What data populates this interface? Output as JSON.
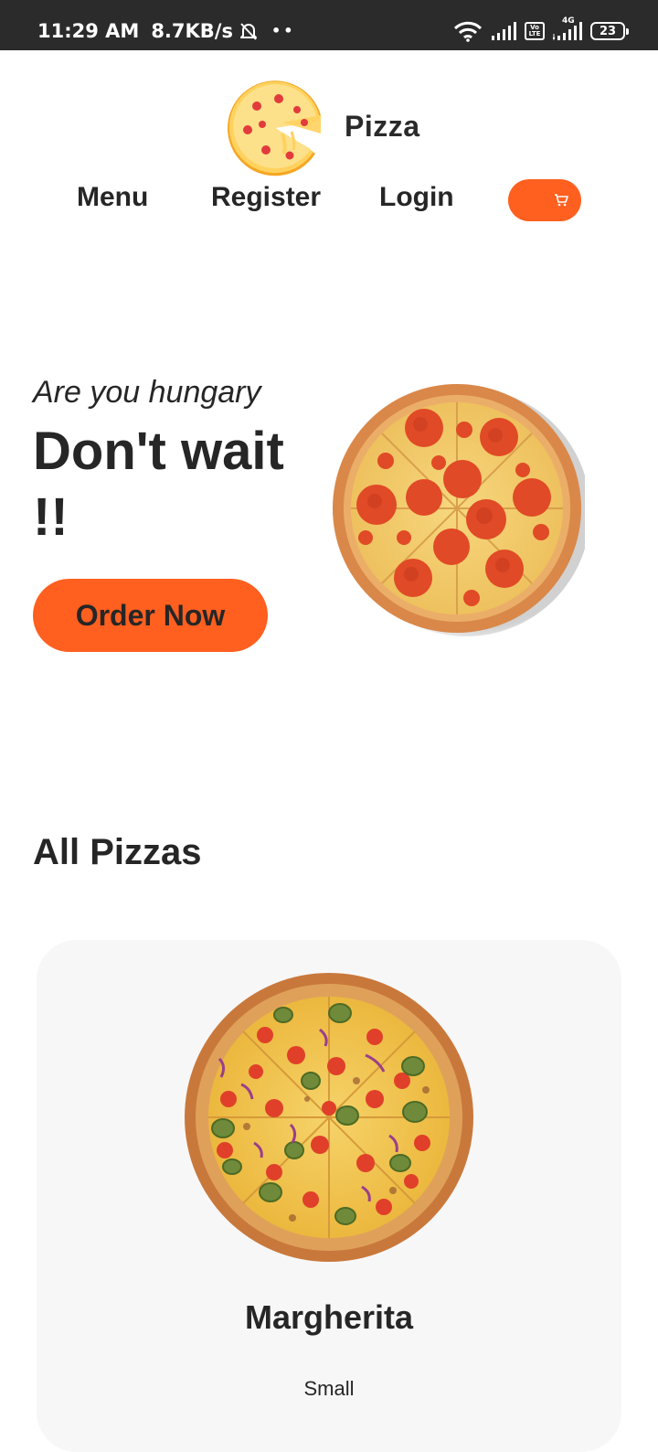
{
  "status_bar": {
    "time": "11:29 AM",
    "net_speed": "8.7KB/s",
    "dots": "••",
    "volte_line1": "Vo",
    "volte_line2": "LTE",
    "network_type": "4G",
    "battery": "23"
  },
  "header": {
    "brand_name": "Pizza",
    "nav": {
      "menu": "Menu",
      "register": "Register",
      "login": "Login"
    }
  },
  "hero": {
    "tagline": "Are you hungary",
    "heading": "Don't wait !!",
    "cta": "Order Now"
  },
  "section": {
    "title": "All Pizzas"
  },
  "pizzas": [
    {
      "name": "Margherita",
      "size": "Small"
    }
  ],
  "colors": {
    "accent": "#ff5f1f",
    "text": "#262626",
    "card_bg": "#f7f7f7",
    "status_bar_bg": "#2b2b2b"
  },
  "icons": {
    "cart": "cart-icon",
    "bell": "bell-off-icon",
    "wifi": "wifi-icon",
    "signal": "signal-icon"
  }
}
